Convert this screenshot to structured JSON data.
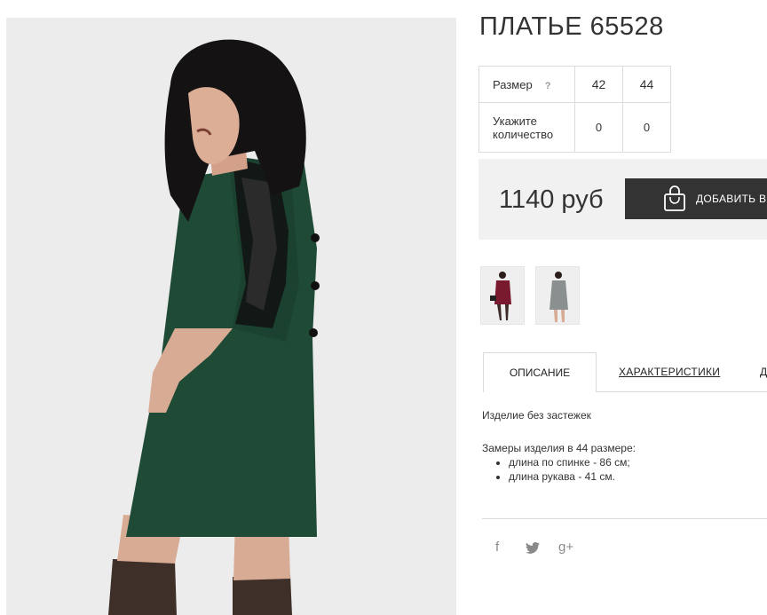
{
  "product": {
    "title": "ПЛАТЬЕ 65528",
    "size_label": "Размер",
    "size_help": "?",
    "sizes": [
      "42",
      "44"
    ],
    "quantity_label_line1": "Укажите",
    "quantity_label_line2": "количество",
    "quantities": [
      "0",
      "0"
    ],
    "price": "1140 руб",
    "add_to_cart": "ДОБАВИТЬ В"
  },
  "thumbnails": [
    {
      "alt": "burgundy dress thumbnail",
      "color": "#7a1a2f"
    },
    {
      "alt": "grey dress thumbnail",
      "color": "#8a9090"
    }
  ],
  "tabs": {
    "description": "ОПИСАНИЕ",
    "characteristics": "ХАРАКТЕРИСТИКИ",
    "third": "Д"
  },
  "description": {
    "line1": "Изделие без застежек",
    "measurements_title": "Замеры изделия в 44 размере:",
    "items": [
      "длина по спинке - 86 см;",
      "длина рукава - 41 см."
    ]
  },
  "social": {
    "facebook": "f",
    "twitter": "twitter-icon",
    "google": "g+"
  },
  "colors": {
    "dress": "#1e4a36",
    "dark_button": "#333333",
    "price_bg": "#f1f1f1"
  }
}
